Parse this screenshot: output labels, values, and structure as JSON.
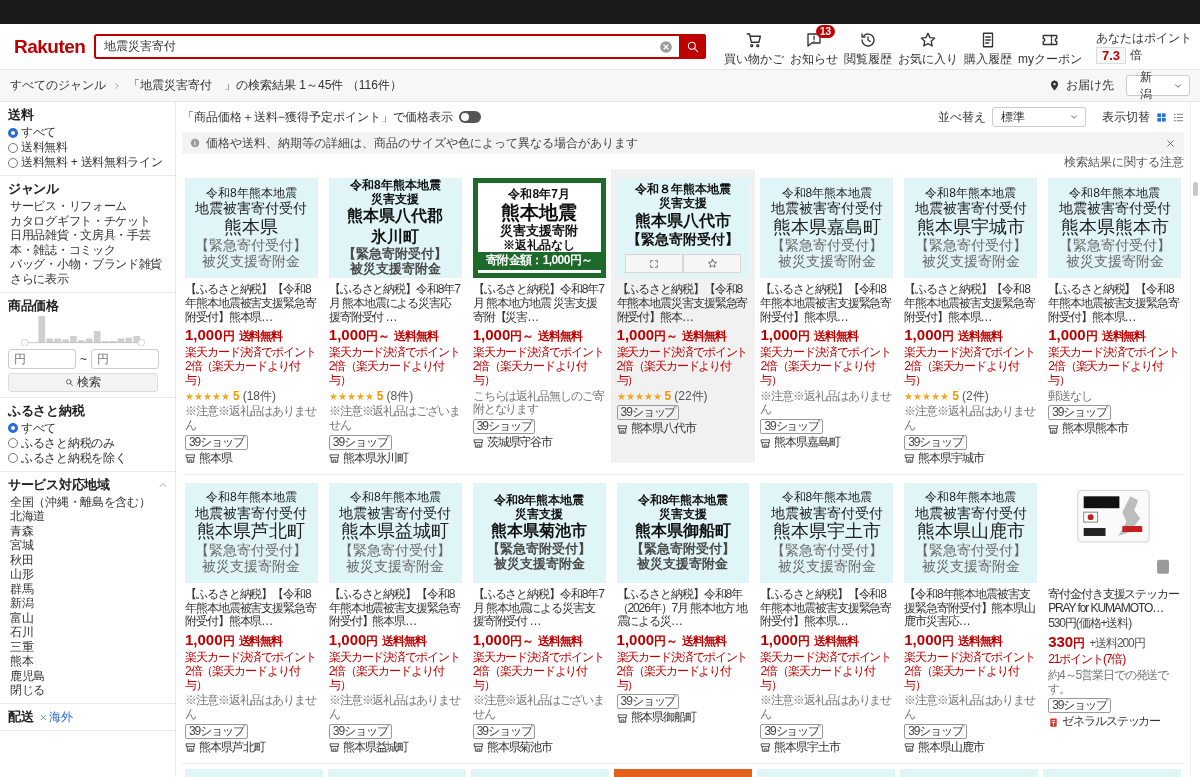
{
  "header": {
    "logo": "Rakuten",
    "search": {
      "value": "地震災害寄付"
    },
    "nav": [
      {
        "kind": "cart",
        "label": "買い物かご"
      },
      {
        "kind": "bell",
        "label": "お知らせ",
        "badge": "13"
      },
      {
        "kind": "history",
        "label": "閲覧履歴"
      },
      {
        "kind": "star",
        "label": "お気に入り"
      },
      {
        "kind": "receipt",
        "label": "購入履歴"
      },
      {
        "kind": "coupon",
        "label": "myクーポン"
      }
    ],
    "points": {
      "label": "あなたはポイント",
      "value": "7.3",
      "unit": "倍"
    }
  },
  "breadcrumb": {
    "root": "すべてのジャンル",
    "result": "「地震災害寄付　」の検索結果 1～45件 （116件）",
    "delivery_label": "お届け先",
    "delivery_value": "新潟"
  },
  "sidebar": {
    "sections": [
      {
        "kind": "radios",
        "title": "送料",
        "options": [
          {
            "label": "すべて",
            "selected": true
          },
          {
            "label": "送料無料",
            "selected": false
          },
          {
            "label": "送料無料 + 送料無料ライン",
            "selected": false
          }
        ]
      },
      {
        "kind": "links",
        "title": "ジャンル",
        "links": [
          "サービス・リフォーム",
          "カタログギフト・チケット",
          "日用品雑貨・文房具・手芸",
          "本・雑誌・コミック",
          "バッグ・小物・ブランド雑貨"
        ],
        "more": "さらに表示"
      },
      {
        "kind": "price",
        "title": "商品価格",
        "min_placeholder": "円",
        "separator": "~",
        "max_placeholder": "円",
        "button": "検索"
      },
      {
        "kind": "radios",
        "title": "ふるさと納税",
        "options": [
          {
            "label": "すべて",
            "selected": true
          },
          {
            "label": "ふるさと納税のみ",
            "selected": false
          },
          {
            "label": "ふるさと納税を除く",
            "selected": false
          }
        ]
      },
      {
        "kind": "links",
        "title": "サービス対応地域",
        "expanded": true,
        "links": [
          "全国（沖縄・離島を含む）",
          "北海道",
          "青森",
          "宮城",
          "秋田",
          "山形",
          "群馬",
          "新潟",
          "富山",
          "石川",
          "三重",
          "熊本",
          "鹿児島"
        ],
        "more": "閉じる"
      },
      {
        "kind": "tag",
        "title": "配送",
        "tag": "海外"
      }
    ]
  },
  "main": {
    "price_toggle": {
      "label": "「商品価格＋送料−獲得予定ポイント」で価格表示",
      "on": false
    },
    "sort": {
      "label": "並べ替え",
      "value": "標準"
    },
    "view": {
      "label": "表示切替",
      "modes": [
        {
          "kind": "grid",
          "selected": true
        },
        {
          "kind": "list",
          "selected": false
        }
      ]
    },
    "notice": "価格や送料、納期等の詳細は、商品のサイズや色によって異なる場合があります",
    "caution_link": "検索結果に関する注意",
    "products": [
      {
        "image": {
          "kind": "light",
          "lines": [
            {
              "text": "令和8年熊本地震",
              "kind": "sub"
            },
            {
              "text": "地震被害寄付受付",
              "kind": "head"
            },
            {
              "text": "熊本県",
              "kind": "place"
            },
            {
              "text": "【緊急寄付受付】",
              "kind": "gray"
            },
            {
              "text": "被災支援寄附金",
              "kind": "gray"
            }
          ]
        },
        "title": "【ふるさと納税】【令和8年熊本地震被害支援緊急寄附受付】熊本県…",
        "price": "1,000",
        "unit": "円",
        "shipping": "送料無料",
        "points": "楽天カード決済でポイント2倍（楽天カードより付与）",
        "stars": 5,
        "rating": "5",
        "reviews": "(18件)",
        "note": "※注意※返礼品はありません",
        "tag": "39ショップ",
        "shop": {
          "name": "熊本県",
          "kind": "storefront"
        },
        "hovered": false
      },
      {
        "image": {
          "kind": "bold",
          "lines": [
            {
              "text": "令和8年熊本地震",
              "kind": "sub"
            },
            {
              "text": "災害支援",
              "kind": "sub"
            },
            {
              "text": "熊本県八代郡",
              "kind": "place"
            },
            {
              "text": "氷川町",
              "kind": "place"
            },
            {
              "text": "【緊急寄附受付】",
              "kind": "gray"
            },
            {
              "text": "被災支援寄附金",
              "kind": "gray"
            }
          ]
        },
        "title": "【ふるさと納税】令和8年7月 熊本地震による災害応援寄附受付 …",
        "price": "1,000",
        "unit": "円～",
        "shipping": "送料無料",
        "points": "楽天カード決済でポイント2倍（楽天カードより付与）",
        "stars": 5,
        "rating": "5",
        "reviews": "(8件)",
        "note": "※注意※返礼品はございません",
        "tag": "39ショップ",
        "shop": {
          "name": "熊本県氷川町",
          "kind": "storefront"
        },
        "hovered": false
      },
      {
        "image": {
          "kind": "green",
          "lines": [
            {
              "text": "令和8年7月",
              "kind": "sub"
            },
            {
              "text": "熊本地震",
              "kind": "place"
            },
            {
              "text": "災害支援寄附",
              "kind": "head"
            },
            {
              "text": "※返礼品なし",
              "kind": "sub"
            }
          ],
          "footer": "寄附金額：1,000円～"
        },
        "title": "【ふるさと納税】令和8年7月 熊本地方地震 災害支援寄附【災害…",
        "price": "1,000",
        "unit": "円～",
        "shipping": "送料無料",
        "points": "楽天カード決済でポイント2倍（楽天カードより付与）",
        "note": "こちらは返礼品無しのご寄附となります",
        "tag": "39ショップ",
        "shop": {
          "name": "茨城県守谷市",
          "kind": "storefront"
        },
        "hovered": false
      },
      {
        "image": {
          "kind": "bold",
          "lines": [
            {
              "text": "令和８年熊本地震",
              "kind": "sub"
            },
            {
              "text": "災害支援",
              "kind": "sub"
            },
            {
              "text": "熊本県八代市",
              "kind": "place"
            },
            {
              "text": "【緊急寄附受付】",
              "kind": "head"
            }
          ]
        },
        "title": "【ふるさと納税】【令和8年熊本地震災害支援緊急寄附受付】熊本…",
        "price": "1,000",
        "unit": "円～",
        "shipping": "送料無料",
        "points": "楽天カード決済でポイント2倍（楽天カードより付与）",
        "stars": 5,
        "rating": "5",
        "reviews": "(22件)",
        "tag": "39ショップ",
        "shop": {
          "name": "熊本県八代市",
          "kind": "storefront"
        },
        "hovered": true
      },
      {
        "image": {
          "kind": "light",
          "lines": [
            {
              "text": "令和8年熊本地震",
              "kind": "sub"
            },
            {
              "text": "地震被害寄付受付",
              "kind": "head"
            },
            {
              "text": "熊本県嘉島町",
              "kind": "place"
            },
            {
              "text": "【緊急寄付受付】",
              "kind": "gray"
            },
            {
              "text": "被災支援寄附金",
              "kind": "gray"
            }
          ]
        },
        "title": "【ふるさと納税】【令和8年熊本地震被害支援緊急寄附受付】熊本県…",
        "price": "1,000",
        "unit": "円",
        "shipping": "送料無料",
        "points": "楽天カード決済でポイント2倍（楽天カードより付与）",
        "note": "※注意※返礼品はありません",
        "tag": "39ショップ",
        "shop": {
          "name": "熊本県嘉島町",
          "kind": "storefront"
        },
        "hovered": false
      },
      {
        "image": {
          "kind": "light",
          "lines": [
            {
              "text": "令和8年熊本地震",
              "kind": "sub"
            },
            {
              "text": "地震被害寄付受付",
              "kind": "head"
            },
            {
              "text": "熊本県宇城市",
              "kind": "place"
            },
            {
              "text": "【緊急寄付受付】",
              "kind": "gray"
            },
            {
              "text": "被災支援寄附金",
              "kind": "gray"
            }
          ]
        },
        "title": "【ふるさと納税】【令和8年熊本地震被害支援緊急寄附受付】熊本県…",
        "price": "1,000",
        "unit": "円",
        "shipping": "送料無料",
        "points": "楽天カード決済でポイント2倍（楽天カードより付与）",
        "stars": 5,
        "rating": "5",
        "reviews": "(2件)",
        "note": "※注意※返礼品はありません",
        "tag": "39ショップ",
        "shop": {
          "name": "熊本県宇城市",
          "kind": "storefront"
        },
        "hovered": false
      },
      {
        "image": {
          "kind": "light",
          "lines": [
            {
              "text": "令和8年熊本地震",
              "kind": "sub"
            },
            {
              "text": "地震被害寄付受付",
              "kind": "head"
            },
            {
              "text": "熊本県熊本市",
              "kind": "place"
            },
            {
              "text": "【緊急寄付受付】",
              "kind": "gray"
            },
            {
              "text": "被災支援寄附金",
              "kind": "gray"
            }
          ]
        },
        "title": "【ふるさと納税】【令和8年熊本地震被害支援緊急寄附受付】熊本県…",
        "price": "1,000",
        "unit": "円",
        "shipping": "送料無料",
        "points": "楽天カード決済でポイント2倍（楽天カードより付与）",
        "note": "郵送なし",
        "tag": "39ショップ",
        "shop": {
          "name": "熊本県熊本市",
          "kind": "storefront"
        },
        "hovered": false
      },
      {
        "image": {
          "kind": "light",
          "lines": [
            {
              "text": "令和8年熊本地震",
              "kind": "sub"
            },
            {
              "text": "地震被害寄付受付",
              "kind": "head"
            },
            {
              "text": "熊本県芦北町",
              "kind": "place"
            },
            {
              "text": "【緊急寄付受付】",
              "kind": "gray"
            },
            {
              "text": "被災支援寄附金",
              "kind": "gray"
            }
          ]
        },
        "title": "【ふるさと納税】【令和8年熊本地震被害支援緊急寄附受付】熊本県…",
        "price": "1,000",
        "unit": "円",
        "shipping": "送料無料",
        "points": "楽天カード決済でポイント2倍（楽天カードより付与）",
        "note": "※注意※返礼品はありません",
        "tag": "39ショップ",
        "shop": {
          "name": "熊本県芦北町",
          "kind": "storefront"
        },
        "hovered": false
      },
      {
        "image": {
          "kind": "light",
          "lines": [
            {
              "text": "令和8年熊本地震",
              "kind": "sub"
            },
            {
              "text": "地震被害寄付受付",
              "kind": "head"
            },
            {
              "text": "熊本県益城町",
              "kind": "place"
            },
            {
              "text": "【緊急寄付受付】",
              "kind": "gray"
            },
            {
              "text": "被災支援寄附金",
              "kind": "gray"
            }
          ]
        },
        "title": "【ふるさと納税】【令和8年熊本地震被害支援緊急寄附受付】熊本県…",
        "price": "1,000",
        "unit": "円",
        "shipping": "送料無料",
        "points": "楽天カード決済でポイント2倍（楽天カードより付与）",
        "note": "※注意※返礼品はありません",
        "tag": "39ショップ",
        "shop": {
          "name": "熊本県益城町",
          "kind": "storefront"
        },
        "hovered": false
      },
      {
        "image": {
          "kind": "bold",
          "lines": [
            {
              "text": "令和8年熊本地震",
              "kind": "sub"
            },
            {
              "text": "災害支援",
              "kind": "sub"
            },
            {
              "text": "熊本県菊池市",
              "kind": "place"
            },
            {
              "text": "【緊急寄附受付】",
              "kind": "gray"
            },
            {
              "text": "被災支援寄附金",
              "kind": "gray"
            }
          ]
        },
        "title": "【ふるさと納税】令和8年7月 熊本地震による災害支援寄附受付 …",
        "price": "1,000",
        "unit": "円～",
        "shipping": "送料無料",
        "points": "楽天カード決済でポイント2倍（楽天カードより付与）",
        "note": "※注意※返礼品はございません",
        "tag": "39ショップ",
        "shop": {
          "name": "熊本県菊池市",
          "kind": "storefront"
        },
        "hovered": false
      },
      {
        "image": {
          "kind": "bold",
          "lines": [
            {
              "text": "令和8年熊本地震",
              "kind": "sub"
            },
            {
              "text": "災害支援",
              "kind": "sub"
            },
            {
              "text": "熊本県御船町",
              "kind": "place"
            },
            {
              "text": "【緊急寄附受付】",
              "kind": "gray"
            },
            {
              "text": "被災支援寄附金",
              "kind": "gray"
            }
          ]
        },
        "title": "【ふるさと納税】令和8年（2026年）7月 熊本地方 地震による災…",
        "price": "1,000",
        "unit": "円～",
        "shipping": "送料無料",
        "points": "楽天カード決済でポイント2倍（楽天カードより付与）",
        "tag": "39ショップ",
        "shop": {
          "name": "熊本県御船町",
          "kind": "storefront"
        },
        "hovered": false
      },
      {
        "image": {
          "kind": "light",
          "lines": [
            {
              "text": "令和8年熊本地震",
              "kind": "sub"
            },
            {
              "text": "地震被害寄付受付",
              "kind": "head"
            },
            {
              "text": "熊本県宇土市",
              "kind": "place"
            },
            {
              "text": "【緊急寄付受付】",
              "kind": "gray"
            },
            {
              "text": "被災支援寄附金",
              "kind": "gray"
            }
          ]
        },
        "title": "【ふるさと納税】【令和8年熊本地震被害支援緊急寄附受付】熊本県…",
        "price": "1,000",
        "unit": "円",
        "shipping": "送料無料",
        "points": "楽天カード決済でポイント2倍（楽天カードより付与）",
        "note": "※注意※返礼品はありません",
        "tag": "39ショップ",
        "shop": {
          "name": "熊本県宇土市",
          "kind": "storefront"
        },
        "hovered": false
      },
      {
        "image": {
          "kind": "light",
          "lines": [
            {
              "text": "令和8年熊本地震",
              "kind": "sub"
            },
            {
              "text": "地震被害寄付受付",
              "kind": "head"
            },
            {
              "text": "熊本県山鹿市",
              "kind": "place"
            },
            {
              "text": "【緊急寄付受付】",
              "kind": "gray"
            },
            {
              "text": "被災支援寄附金",
              "kind": "gray"
            }
          ]
        },
        "title": "【令和8年熊本地震被害支援緊急寄附受付】熊本県山鹿市災害応…",
        "price": "1,000",
        "unit": "円",
        "shipping": "送料無料",
        "points": "楽天カード決済でポイント2倍（楽天カードより付与）",
        "note": "※注意※返礼品はありません",
        "tag": "39ショップ",
        "shop": {
          "name": "熊本県山鹿市",
          "kind": "storefront"
        },
        "hovered": false
      },
      {
        "title": "寄付金付き支援ステッカー PRAY for KUMAMOTO…",
        "pre_price": "530円(価格+送料)",
        "price": "330",
        "unit": "円",
        "extra": "+送料200円",
        "points": "21ポイント(7倍)",
        "note": "約4～5営業日での発送です。",
        "tag": "39ショップ",
        "shop": {
          "name": "ゼネラルステッカー",
          "kind": "logo"
        },
        "hovered": false
      }
    ],
    "more_products": [
      {
        "kind": "light"
      },
      {
        "kind": "light"
      },
      {
        "kind": "light"
      },
      {
        "kind": "orange"
      },
      {
        "kind": "light"
      },
      {
        "kind": "light"
      },
      {
        "kind": "light"
      }
    ]
  }
}
